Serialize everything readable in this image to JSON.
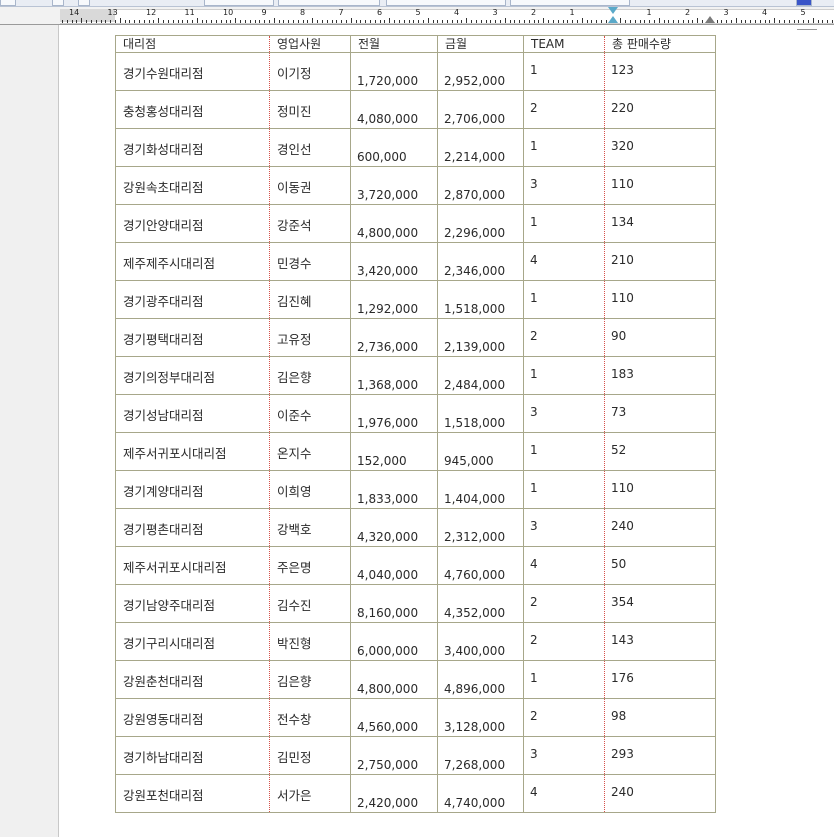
{
  "ruler": {
    "numbers": [
      "14",
      "13",
      "12",
      "11",
      "10",
      "9",
      "8",
      "7",
      "6",
      "5",
      "4",
      "3",
      "2",
      "1",
      "1",
      "2",
      "3",
      "4",
      "5"
    ]
  },
  "table": {
    "headers": [
      "대리점",
      "영업사원",
      "전월",
      "금월",
      "TEAM",
      "총 판매수량"
    ],
    "rows": [
      {
        "branch": "경기수원대리점",
        "rep": "이기정",
        "prev": "1,720,000",
        "curr": "2,952,000",
        "team": "1",
        "qty": "123"
      },
      {
        "branch": "충청홍성대리점",
        "rep": "정미진",
        "prev": "4,080,000",
        "curr": "2,706,000",
        "team": "2",
        "qty": "220"
      },
      {
        "branch": "경기화성대리점",
        "rep": "경인선",
        "prev": "600,000",
        "curr": "2,214,000",
        "team": "1",
        "qty": "320"
      },
      {
        "branch": "강원속초대리점",
        "rep": "이동권",
        "prev": "3,720,000",
        "curr": "2,870,000",
        "team": "3",
        "qty": "110"
      },
      {
        "branch": "경기안양대리점",
        "rep": "강준석",
        "prev": "4,800,000",
        "curr": "2,296,000",
        "team": "1",
        "qty": "134"
      },
      {
        "branch": "제주제주시대리점",
        "rep": "민경수",
        "prev": "3,420,000",
        "curr": "2,346,000",
        "team": "4",
        "qty": "210"
      },
      {
        "branch": "경기광주대리점",
        "rep": "김진혜",
        "prev": "1,292,000",
        "curr": "1,518,000",
        "team": "1",
        "qty": "110"
      },
      {
        "branch": "경기평택대리점",
        "rep": "고유정",
        "prev": "2,736,000",
        "curr": "2,139,000",
        "team": "2",
        "qty": "90"
      },
      {
        "branch": "경기의정부대리점",
        "rep": "김은향",
        "prev": "1,368,000",
        "curr": "2,484,000",
        "team": "1",
        "qty": "183"
      },
      {
        "branch": "경기성남대리점",
        "rep": "이준수",
        "prev": "1,976,000",
        "curr": "1,518,000",
        "team": "3",
        "qty": "73"
      },
      {
        "branch": "제주서귀포시대리점",
        "rep": "온지수",
        "prev": "152,000",
        "curr": "945,000",
        "team": "1",
        "qty": "52"
      },
      {
        "branch": "경기계양대리점",
        "rep": "이희영",
        "prev": "1,833,000",
        "curr": "1,404,000",
        "team": "1",
        "qty": "110"
      },
      {
        "branch": "경기평촌대리점",
        "rep": "강백호",
        "prev": "4,320,000",
        "curr": "2,312,000",
        "team": "3",
        "qty": "240"
      },
      {
        "branch": "제주서귀포시대리점",
        "rep": "주은명",
        "prev": "4,040,000",
        "curr": "4,760,000",
        "team": "4",
        "qty": "50"
      },
      {
        "branch": "경기남양주대리점",
        "rep": "김수진",
        "prev": "8,160,000",
        "curr": "4,352,000",
        "team": "2",
        "qty": "354"
      },
      {
        "branch": "경기구리시대리점",
        "rep": "박진형",
        "prev": "6,000,000",
        "curr": "3,400,000",
        "team": "2",
        "qty": "143"
      },
      {
        "branch": "강원춘천대리점",
        "rep": "김은향",
        "prev": "4,800,000",
        "curr": "4,896,000",
        "team": "1",
        "qty": "176"
      },
      {
        "branch": "강원영동대리점",
        "rep": "전수창",
        "prev": "4,560,000",
        "curr": "3,128,000",
        "team": "2",
        "qty": "98"
      },
      {
        "branch": "경기하남대리점",
        "rep": "김민정",
        "prev": "2,750,000",
        "curr": "7,268,000",
        "team": "3",
        "qty": "293"
      },
      {
        "branch": "강원포천대리점",
        "rep": "서가은",
        "prev": "2,420,000",
        "curr": "4,740,000",
        "team": "4",
        "qty": "240"
      }
    ]
  }
}
